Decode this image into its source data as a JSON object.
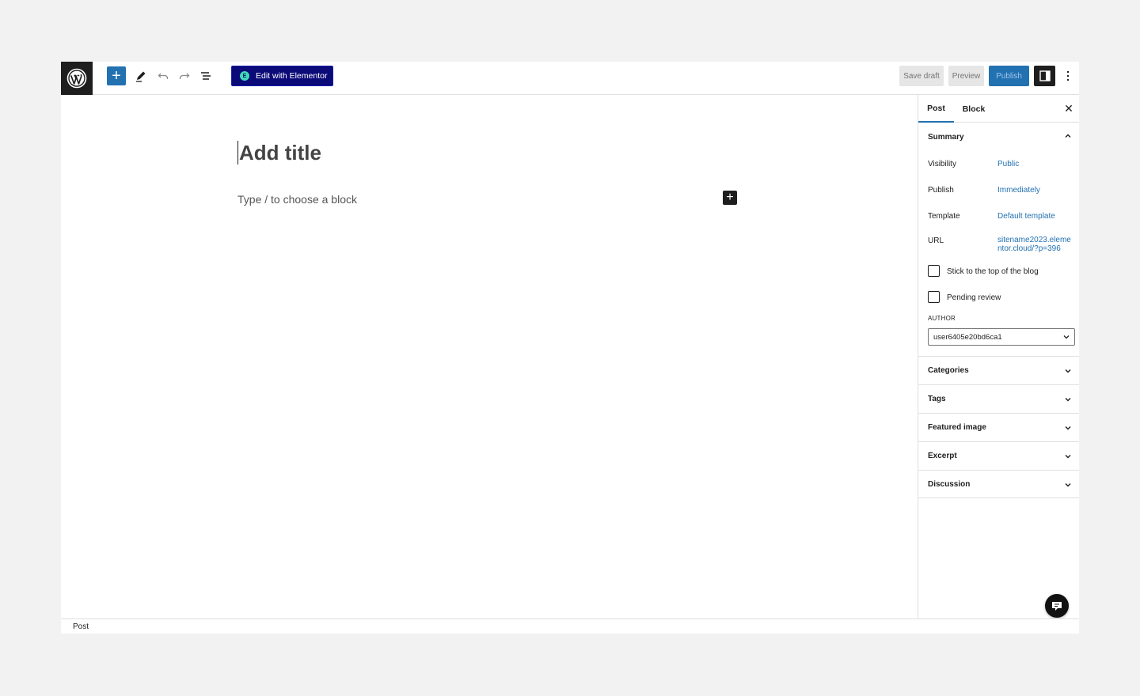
{
  "toolbar": {
    "add_block_symbol": "+",
    "elementor_button": "Edit with Elementor",
    "elementor_badge": "E",
    "save_draft": "Save draft",
    "preview": "Preview",
    "publish": "Publish"
  },
  "editor": {
    "title_placeholder": "Add title",
    "block_placeholder": "Type / to choose a block",
    "block_adder_symbol": "+"
  },
  "sidebar": {
    "tabs": [
      "Post",
      "Block"
    ],
    "close_symbol": "✕",
    "summary": {
      "title": "Summary",
      "rows": [
        {
          "label": "Visibility",
          "value": "Public"
        },
        {
          "label": "Publish",
          "value": "Immediately"
        },
        {
          "label": "Template",
          "value": "Default template"
        },
        {
          "label": "URL",
          "value": "sitename2023.elementor.cloud/?p=396"
        }
      ],
      "checkboxes": [
        {
          "label": "Stick to the top of the blog",
          "checked": false
        },
        {
          "label": "Pending review",
          "checked": false
        }
      ],
      "author_label": "AUTHOR",
      "author_value": "user6405e20bd6ca1"
    },
    "panels": [
      "Categories",
      "Tags",
      "Featured image",
      "Excerpt",
      "Discussion"
    ]
  },
  "footer": {
    "breadcrumb": "Post"
  },
  "colors": {
    "accent": "#2271b1",
    "elementor_bg": "#0a0a78",
    "dark": "#1e1e1e"
  }
}
